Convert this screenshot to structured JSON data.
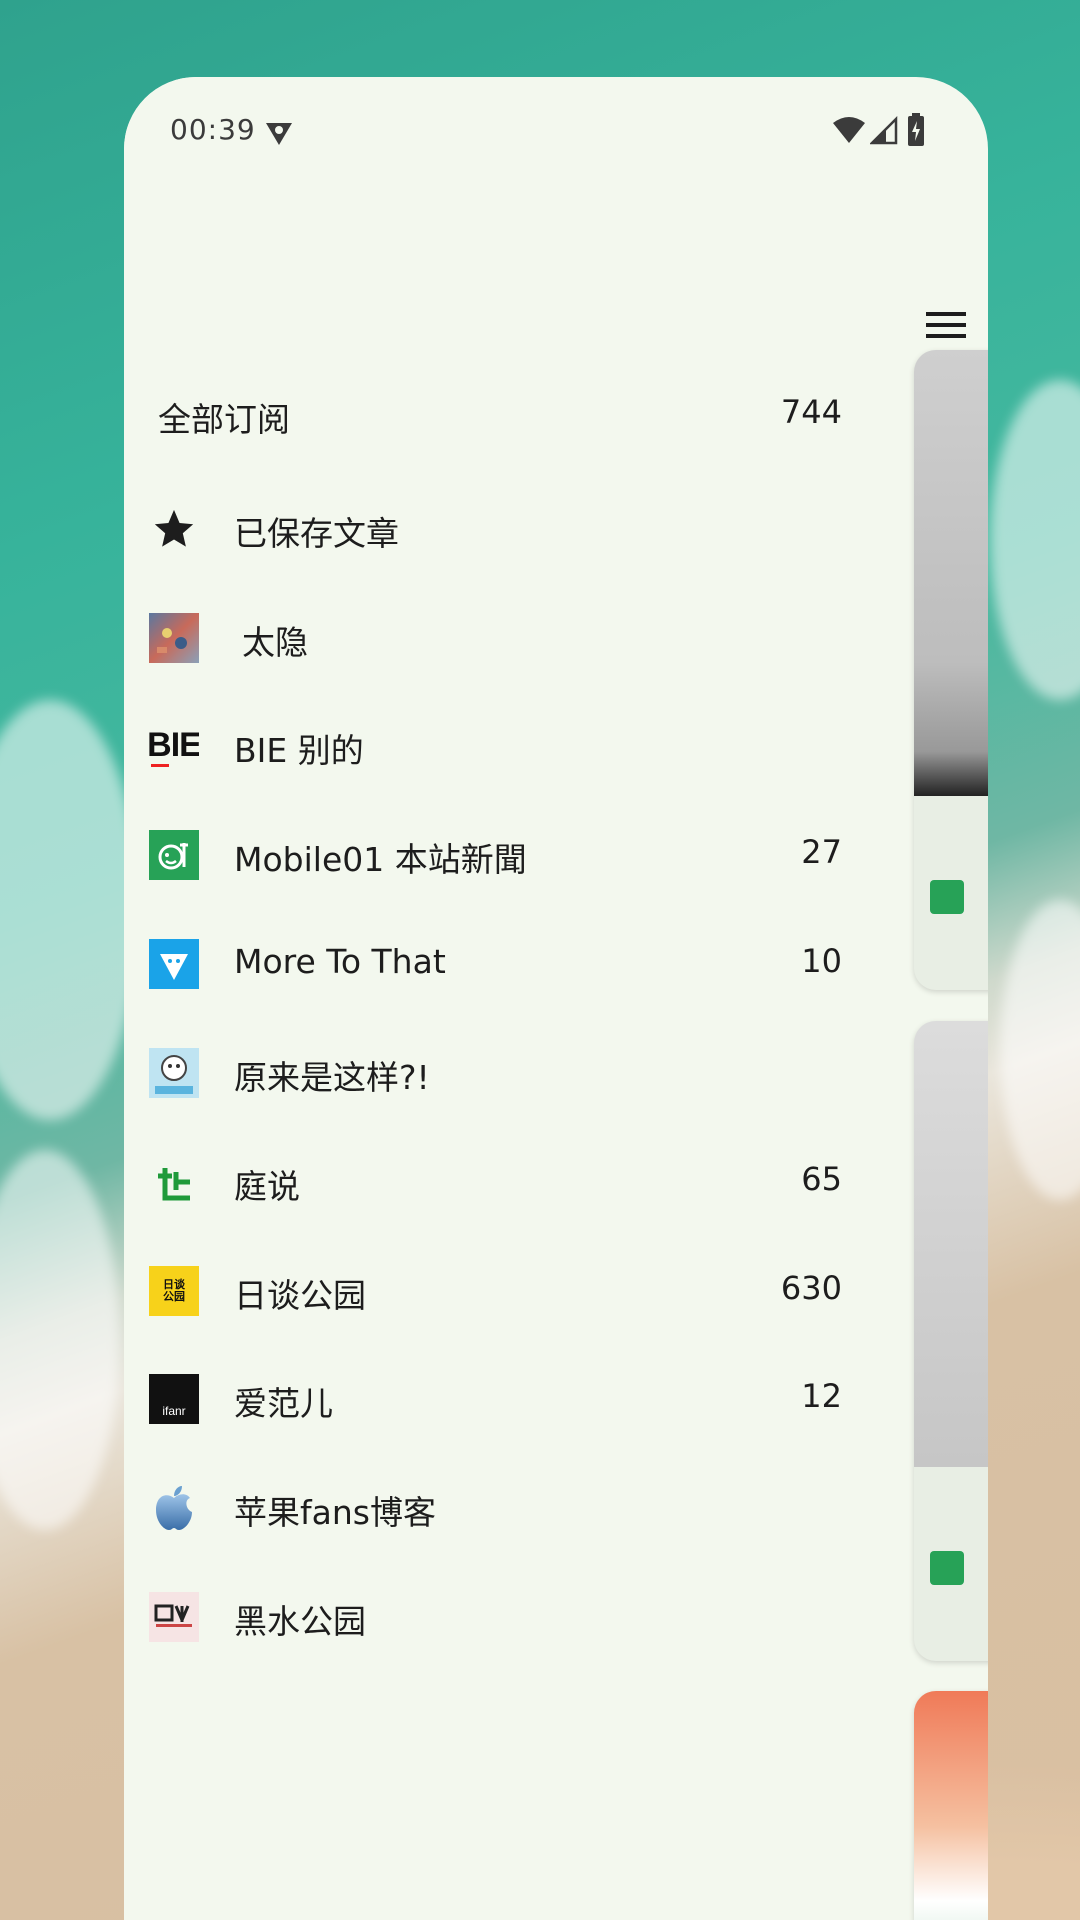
{
  "status_bar": {
    "time": "00:39"
  },
  "drawer": {
    "all_subscriptions": {
      "label": "全部订阅",
      "count": "744"
    },
    "feeds": [
      {
        "label": "已保存文章",
        "count": "",
        "icon": "star-icon"
      },
      {
        "label": "太隐",
        "count": "",
        "icon": "taiyin-avatar-icon"
      },
      {
        "label": "BIE 别的",
        "count": "",
        "icon": "bie-logo-icon"
      },
      {
        "label": "Mobile01 本站新聞",
        "count": "27",
        "icon": "mobile01-logo-icon"
      },
      {
        "label": "More To That",
        "count": "10",
        "icon": "more-to-that-logo-icon"
      },
      {
        "label": "原来是这样?!",
        "count": "",
        "icon": "yuanlai-logo-icon"
      },
      {
        "label": "庭说",
        "count": "65",
        "icon": "tingshuo-logo-icon"
      },
      {
        "label": "日谈公园",
        "count": "630",
        "icon": "ritan-park-logo-icon"
      },
      {
        "label": "爱范儿",
        "count": "12",
        "icon": "ifanr-logo-icon"
      },
      {
        "label": "苹果fans博客",
        "count": "",
        "icon": "apple-logo-icon"
      },
      {
        "label": "黑水公园",
        "count": "",
        "icon": "heishui-logo-icon"
      }
    ]
  },
  "icon_texts": {
    "bie": "BIE",
    "ifanr": "ifanr",
    "ritan": "日谈公园"
  },
  "colors": {
    "drawer_bg": "#f3f8ee",
    "mobile01_green": "#27a257",
    "more_to_that_blue": "#1aa3e8",
    "tingshuo_green": "#1f9a3a",
    "ritan_yellow": "#f7d21a"
  }
}
